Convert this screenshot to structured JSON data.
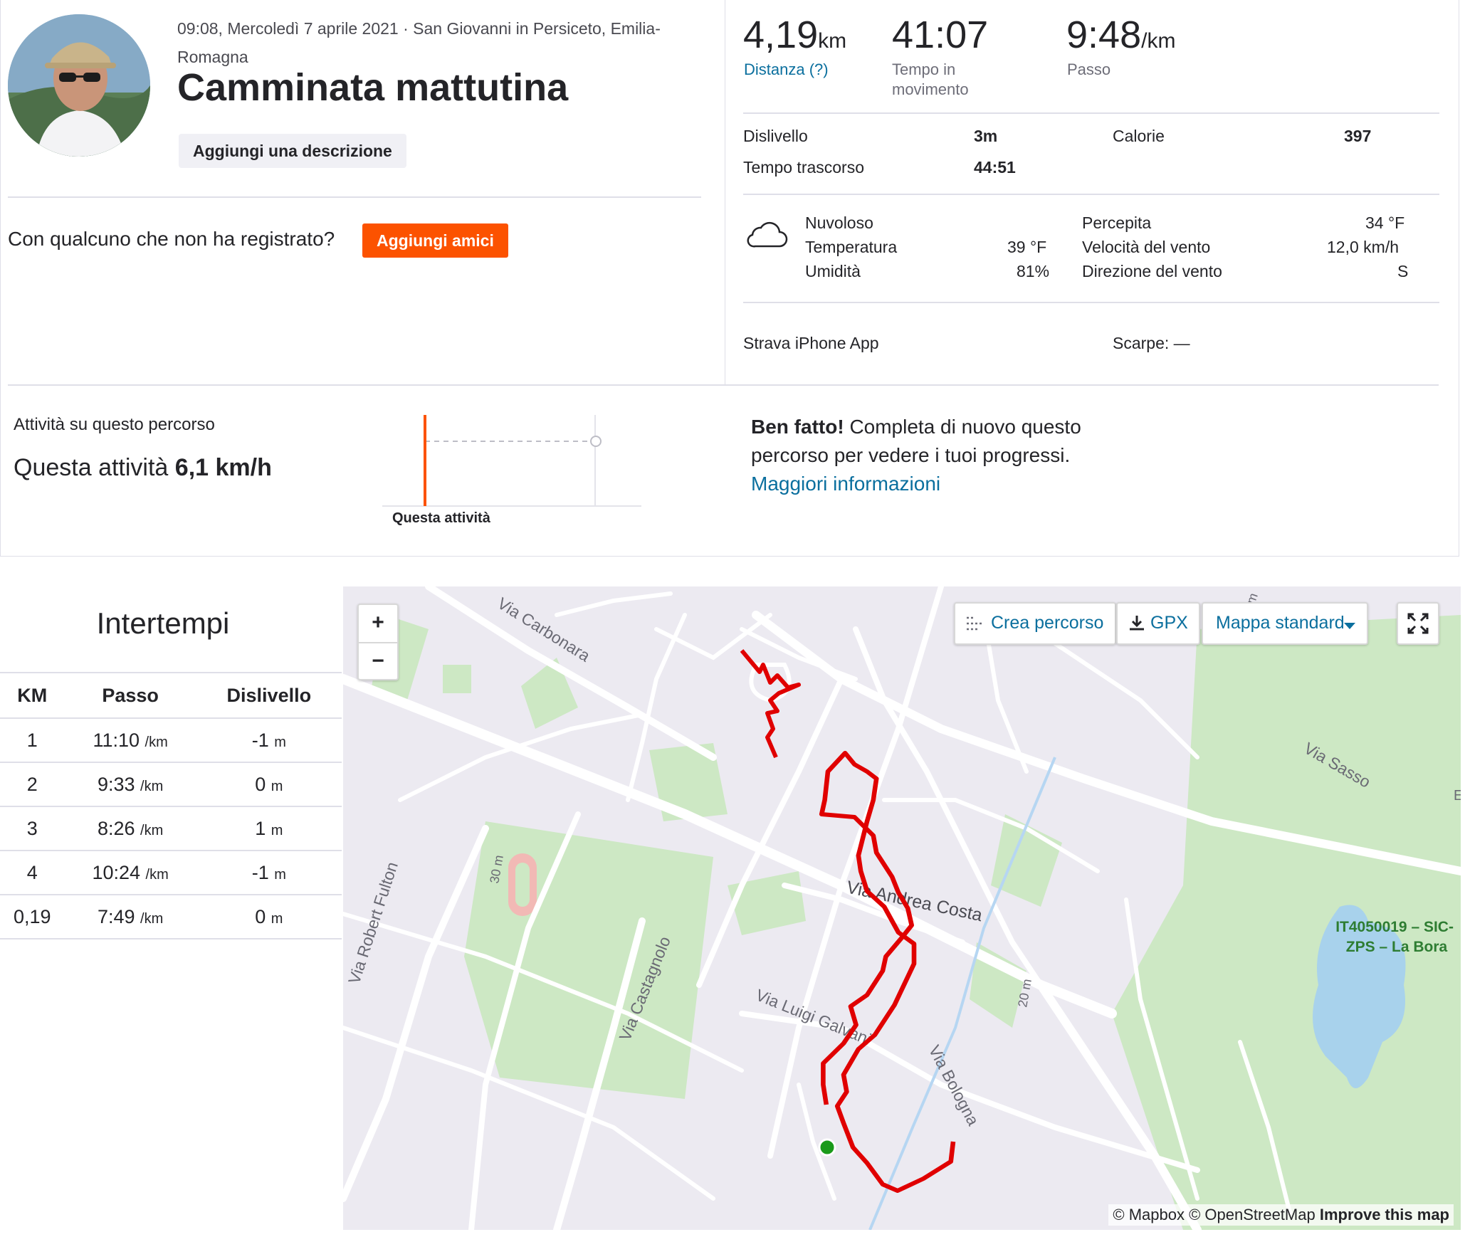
{
  "activity": {
    "datetime_location": "09:08, Mercoledì 7 aprile 2021 · San Giovanni in Persiceto, Emilia-Romagna",
    "title": "Camminata mattutina",
    "add_description_label": "Aggiungi una descrizione",
    "friends_question": "Con qualcuno che non ha registrato?",
    "add_friends_label": "Aggiungi amici"
  },
  "stats": {
    "distance_value": "4,19",
    "distance_unit": "km",
    "distance_label": "Distanza (?)",
    "moving_time_value": "41:07",
    "moving_time_label": "Tempo in movimento",
    "pace_value": "9:48",
    "pace_unit": "/km",
    "pace_label": "Passo",
    "elevation_label": "Dislivello",
    "elevation_value": "3m",
    "calories_label": "Calorie",
    "calories_value": "397",
    "elapsed_label": "Tempo trascorso",
    "elapsed_value": "44:51"
  },
  "weather": {
    "icon": "cloud-icon",
    "condition": "Nuvoloso",
    "temp_label": "Temperatura",
    "temp_value": "39 °F",
    "humidity_label": "Umidità",
    "humidity_value": "81%",
    "feels_label": "Percepita",
    "feels_value": "34 °F",
    "wind_speed_label": "Velocità del vento",
    "wind_speed_value": "12,0 km/h",
    "wind_dir_label": "Direzione del vento",
    "wind_dir_value": "S"
  },
  "device": {
    "app_label": "Strava iPhone App",
    "shoes_label": "Scarpe: —"
  },
  "segment": {
    "title": "Attività su questo percorso",
    "speed_prefix": "Questa attività",
    "speed_value": "6,1 km/h",
    "chart_label": "Questa attività",
    "well_done_bold": "Ben fatto!",
    "well_done_text": "Completa di nuovo questo percorso per vedere i tuoi progressi.",
    "more_info_label": "Maggiori informazioni"
  },
  "splits": {
    "title": "Intertempi",
    "headers": [
      "KM",
      "Passo",
      "Dislivello"
    ],
    "pace_unit": "/km",
    "elev_unit": "m",
    "rows": [
      {
        "km": "1",
        "pace": "11:10",
        "elev": "-1"
      },
      {
        "km": "2",
        "pace": "9:33",
        "elev": "0"
      },
      {
        "km": "3",
        "pace": "8:26",
        "elev": "1"
      },
      {
        "km": "4",
        "pace": "10:24",
        "elev": "-1"
      },
      {
        "km": "0,19",
        "pace": "7:49",
        "elev": "0"
      }
    ]
  },
  "map": {
    "zoom_in": "+",
    "zoom_out": "−",
    "create_route_label": "Crea percorso",
    "gpx_label": "GPX",
    "map_style_label": "Mappa standard",
    "streets": [
      "Via Carbonara",
      "Via Sasso",
      "Via Robert Fulton",
      "Via Andrea Costa",
      "Via Castagnolo",
      "Via Luigi Galvani",
      "Via Bologna",
      "30 m",
      "20 m",
      "m",
      "E"
    ],
    "poi": "IT4050019 – SIC-ZPS – La Bora",
    "attribution": "© Mapbox © OpenStreetMap",
    "improve_label": "Improve this map",
    "accent_color": "#fc5200",
    "route_color": "#e00000",
    "start_color": "#1a9a1a"
  }
}
